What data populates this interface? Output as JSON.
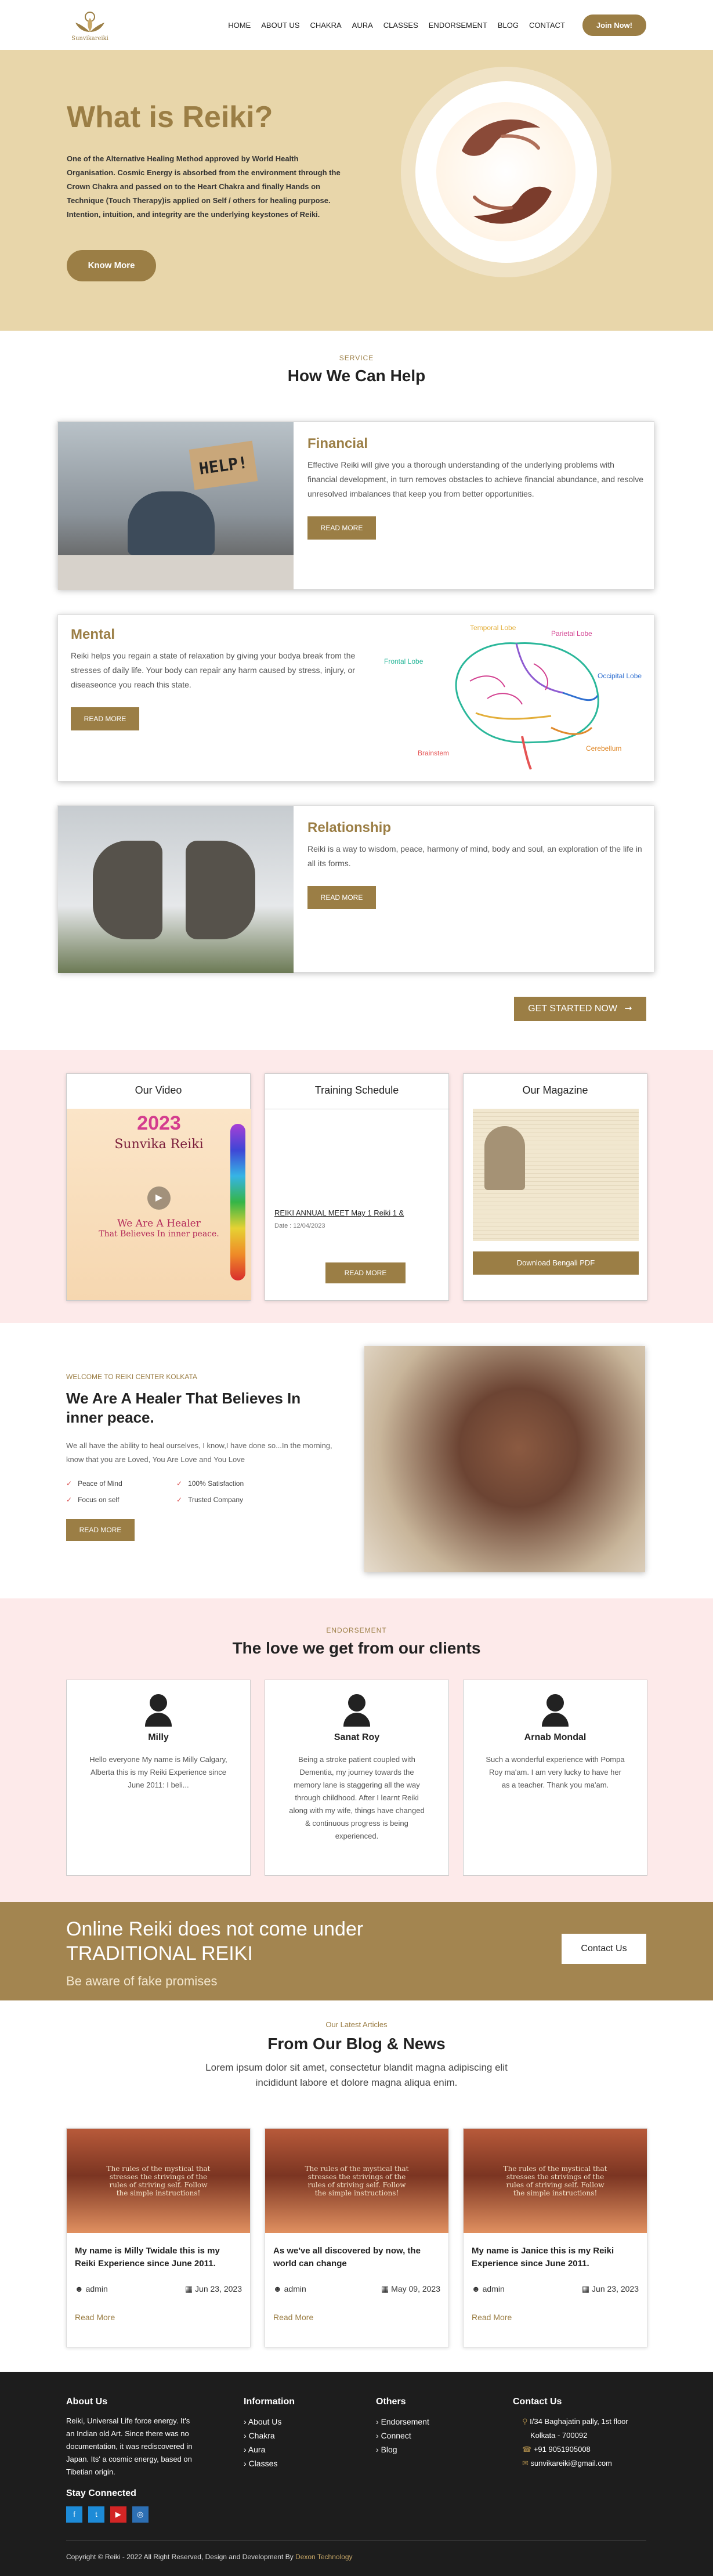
{
  "header": {
    "logo_text": "Sunvikareiki",
    "nav": [
      "HOME",
      "ABOUT US",
      "CHAKRA",
      "AURA",
      "CLASSES",
      "ENDORSEMENT",
      "BLOG",
      "CONTACT"
    ],
    "join_label": "Join Now!"
  },
  "hero": {
    "title": "What is Reiki?",
    "body": "One of the Alternative Healing Method approved by World Health Organisation. Cosmic Energy is absorbed from the environment through the Crown Chakra and passed on to the Heart Chakra and finally Hands on Technique (Touch Therapy)is applied on Self / others for healing purpose. Intention, intuition, and integrity are the underlying keystones of Reiki.",
    "cta": "Know More"
  },
  "help": {
    "kicker": "SERVICE",
    "heading": "How We Can Help",
    "cards": [
      {
        "title": "Financial",
        "body": "Effective Reiki will give you a thorough understanding of the underlying problems with financial development, in turn removes obstacles to achieve financial abundance, and resolve unresolved imbalances that keep you from better opportunities.",
        "button": "READ MORE",
        "sign": "HELP!"
      },
      {
        "title": "Mental",
        "body": "Reiki helps you regain a state of relaxation by giving your bodya break from the stresses of daily life. Your body can repair any harm caused by stress, injury, or diseaseonce you reach this state.",
        "button": "READ MORE"
      },
      {
        "title": "Relationship",
        "body": "Reiki is a way to wisdom, peace, harmony of mind, body and soul, an exploration of the life in all its forms.",
        "button": "READ MORE"
      }
    ],
    "brain_labels": [
      "Temporal Lobe",
      "Parietal Lobe",
      "Frontal Lobe",
      "Occipital Lobe",
      "Brainstem",
      "Cerebellum"
    ],
    "get_started": "GET STARTED NOW"
  },
  "trio": {
    "video": {
      "title": "Our Video",
      "poster_year": "2023",
      "poster_brand": "Sunvika Reiki",
      "poster_heal": "We Are A Healer",
      "poster_belief": "That Believes In inner peace."
    },
    "schedule": {
      "title": "Training Schedule",
      "event": "REIKI ANNUAL MEET May 1 Reiki 1 &",
      "date": "Date : 12/04/2023",
      "button": "READ MORE"
    },
    "magazine": {
      "title": "Our Magazine",
      "button": "Download Bengali PDF"
    }
  },
  "about": {
    "kicker": "WELCOME TO REIKI CENTER KOLKATA",
    "heading": "We Are A Healer That Believes In inner peace.",
    "body": "We all have the ability to heal ourselves, I know,I have done so...In the morning, know that you are Loved, You Are Love and You Love",
    "checks": [
      "Peace of Mind",
      "100% Satisfaction",
      "Focus on self",
      "Trusted Company"
    ],
    "button": "READ MORE"
  },
  "endorse": {
    "kicker": "ENDORSEMENT",
    "heading": "The love we get from our clients",
    "items": [
      {
        "name": "Milly",
        "text": "Hello everyone My name is Milly Calgary, Alberta this is my Reiki Experience since June 2011: I beli..."
      },
      {
        "name": "Sanat Roy",
        "text": "Being a stroke patient coupled with Dementia, my journey towards the memory lane is staggering all the way through childhood. After I learnt Reiki along with my wife, things have changed & continuous progress is being experienced."
      },
      {
        "name": "Arnab Mondal",
        "text": "Such a wonderful experience with Pompa Roy ma'am. I am very lucky to have her as a teacher. Thank you ma'am."
      }
    ]
  },
  "banner": {
    "line1": "Online Reiki does not come under",
    "line2": "TRADITIONAL REIKI",
    "sub": "Be aware of fake promises",
    "button": "Contact Us"
  },
  "blog": {
    "kicker": "Our Latest Articles",
    "heading": "From Our Blog & News",
    "intro": "Lorem ipsum dolor sit amet, consectetur blandit magna adipiscing elit incididunt labore et dolore magna aliqua enim.",
    "image_quote": "The rules of the mystical that stresses the strivings of the rules of striving self. Follow the simple instructions!",
    "posts": [
      {
        "title": "My name is Milly Twidale this is my Reiki Experience since June 2011.",
        "author": "admin",
        "date": "Jun 23, 2023",
        "more": "Read More"
      },
      {
        "title": "As we've all discovered by now, the world can change",
        "author": "admin",
        "date": "May 09, 2023",
        "more": "Read More"
      },
      {
        "title": "My name is Janice this is my Reiki Experience since June 2011.",
        "author": "admin",
        "date": "Jun 23, 2023",
        "more": "Read More"
      }
    ]
  },
  "footer": {
    "about_title": "About Us",
    "about_text": "Reiki, Universal Life force energy. It's an Indian old Art. Since there was no documentation, it was rediscovered in Japan. Its' a cosmic energy, based on Tibetian origin.",
    "stay": "Stay Connected",
    "info_title": "Information",
    "info_links": [
      "About Us",
      "Chakra",
      "Aura",
      "Classes"
    ],
    "others_title": "Others",
    "others_links": [
      "Endorsement",
      "Connect",
      "Blog"
    ],
    "contact_title": "Contact Us",
    "address": "I/34 Baghajatin pally, 1st floor Kolkata - 700092",
    "phone": "+91 9051905008",
    "email": "sunvikareiki@gmail.com",
    "copyright": "Copyright © Reiki - 2022 All Right Reserved, Design and Development By",
    "designer": "Dexon Technology"
  },
  "colors": {
    "accent": "#9b7e45",
    "hero_bg": "#e8d6aa",
    "pink_bg": "#fdeaea",
    "footer_bg": "#1d1d1d"
  }
}
